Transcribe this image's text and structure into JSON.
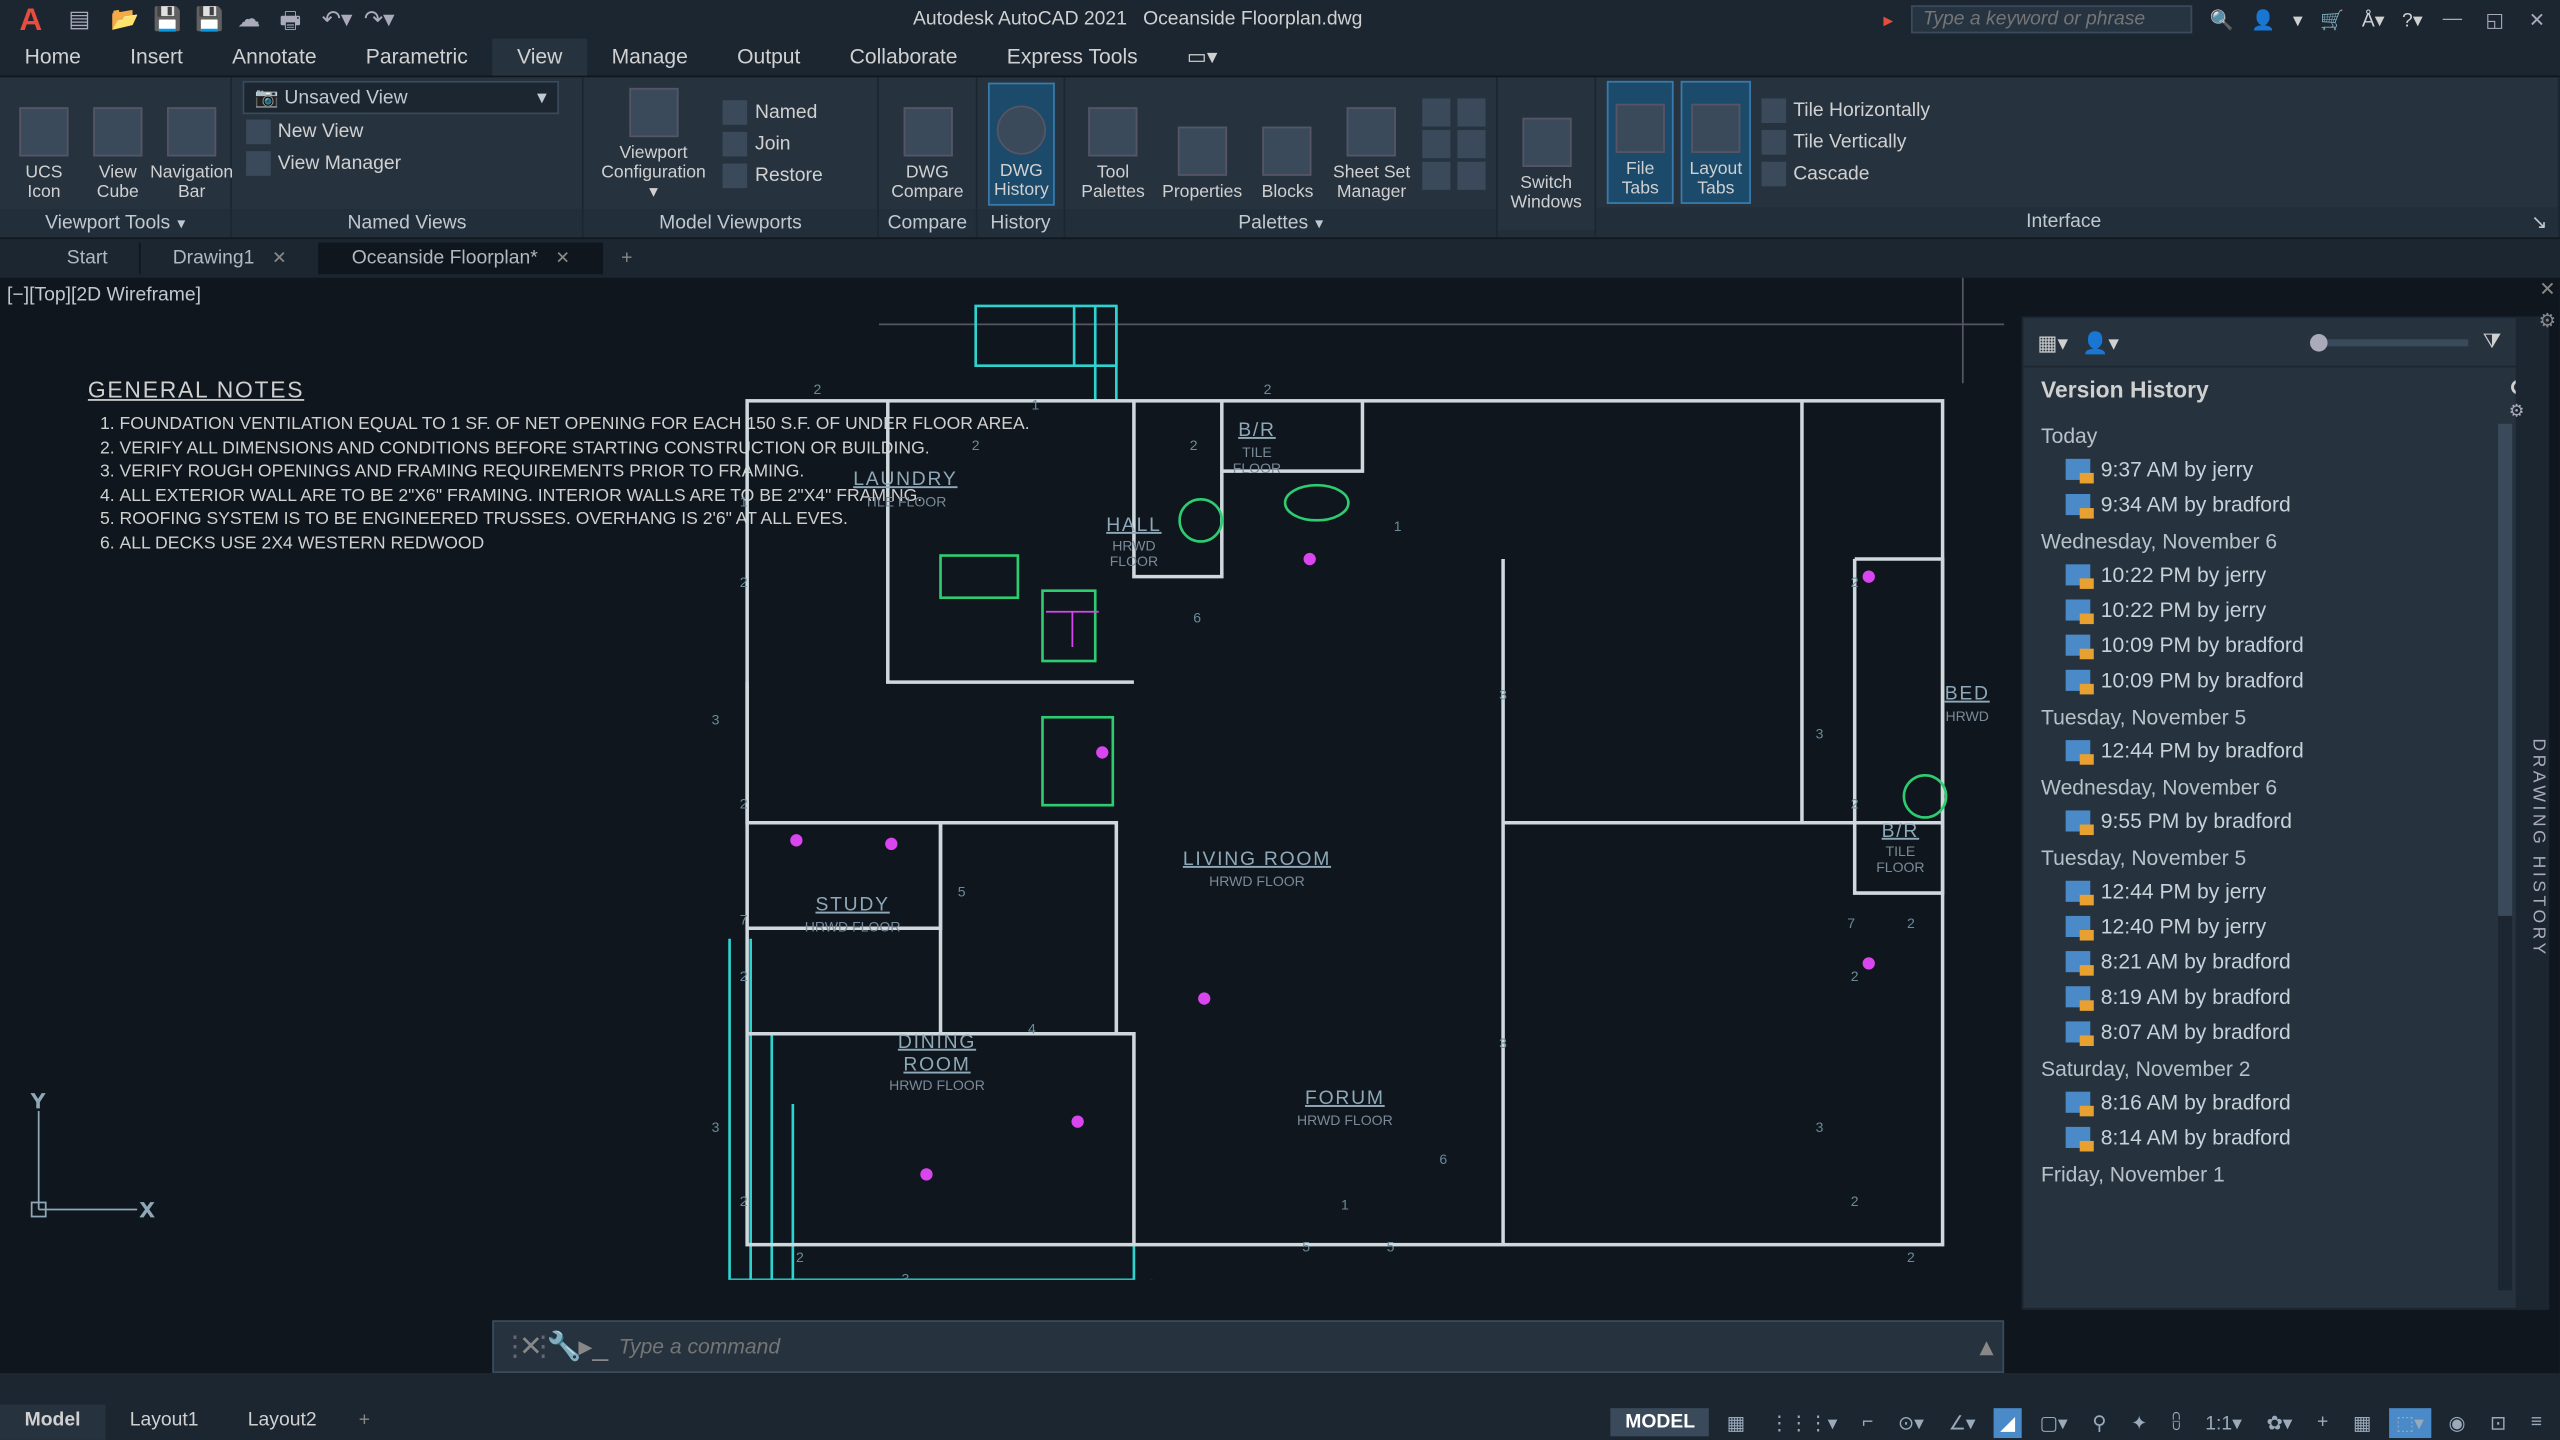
{
  "app": {
    "name": "Autodesk AutoCAD 2021",
    "doc": "Oceanside Floorplan.dwg"
  },
  "search": {
    "placeholder": "Type a keyword or phrase"
  },
  "menu": [
    "Home",
    "Insert",
    "Annotate",
    "Parametric",
    "View",
    "Manage",
    "Output",
    "Collaborate",
    "Express Tools"
  ],
  "menu_active": "View",
  "ribbon": {
    "viewport_tools": {
      "ucs": "UCS\nIcon",
      "cube": "View\nCube",
      "nav": "Navigation\nBar",
      "title": "Viewport Tools"
    },
    "named_views": {
      "combo": "Unsaved View",
      "named": "Named",
      "new": "New View",
      "mgr": "View Manager",
      "title": "Named Views"
    },
    "model_vp": {
      "cfg": "Viewport\nConfiguration",
      "join": "Join",
      "restore": "Restore",
      "title": "Model Viewports"
    },
    "compare": {
      "dwg": "DWG\nCompare",
      "title": "Compare"
    },
    "history": {
      "dwg": "DWG\nHistory",
      "title": "History"
    },
    "palettes": {
      "tool": "Tool\nPalettes",
      "prop": "Properties",
      "blocks": "Blocks",
      "sheet": "Sheet Set\nManager",
      "title": "Palettes"
    },
    "switch": "Switch\nWindows",
    "interface": {
      "file": "File\nTabs",
      "layout": "Layout\nTabs",
      "th": "Tile Horizontally",
      "tv": "Tile Vertically",
      "cas": "Cascade",
      "title": "Interface"
    }
  },
  "doctabs": [
    "Start",
    "Drawing1",
    "Oceanside Floorplan*"
  ],
  "viewlabel": "[−][Top][2D Wireframe]",
  "notes": {
    "title": "GENERAL NOTES",
    "items": [
      "FOUNDATION VENTILATION EQUAL TO 1 SF. OF NET OPENING FOR EACH 150 S.F. OF UNDER FLOOR AREA.",
      "VERIFY ALL DIMENSIONS AND CONDITIONS BEFORE STARTING CONSTRUCTION OR BUILDING.",
      "VERIFY ROUGH OPENINGS AND FRAMING REQUIREMENTS PRIOR TO FRAMING.",
      "ALL EXTERIOR WALL ARE TO BE 2\"X6\" FRAMING. INTERIOR WALLS ARE TO BE 2\"X4\" FRAMING.",
      "ROOFING SYSTEM IS TO BE ENGINEERED TRUSSES. OVERHANG IS 2'6\" AT ALL EVES.",
      "ALL DECKS USE 2X4 WESTERN REDWOOD"
    ]
  },
  "rooms": {
    "laundry": {
      "n": "LAUNDRY",
      "s": "TILE  FLOOR"
    },
    "br": {
      "n": "B/R",
      "s": "TILE\nFLOOR"
    },
    "hall": {
      "n": "HALL",
      "s": "HRWD\nFLOOR"
    },
    "living": {
      "n": "LIVING  ROOM",
      "s": "HRWD  FLOOR"
    },
    "study": {
      "n": "STUDY",
      "s": "HRWD  FLOOR"
    },
    "dining": {
      "n": "DINING\nROOM",
      "s": "HRWD  FLOOR"
    },
    "forum": {
      "n": "FORUM",
      "s": "HRWD  FLOOR"
    },
    "bed": {
      "n": "BED",
      "s": "HRWD"
    },
    "br2": {
      "n": "B/R",
      "s": "TILE\nFLOOR"
    }
  },
  "vh": {
    "title": "Version History",
    "groups": [
      {
        "d": "Today",
        "items": [
          "9:37 AM by jerry",
          "9:34 AM by bradford"
        ]
      },
      {
        "d": "Wednesday, November 6",
        "items": [
          "10:22 PM by jerry",
          "10:22 PM by jerry",
          "10:09 PM by bradford",
          "10:09 PM by bradford"
        ]
      },
      {
        "d": "Tuesday, November 5",
        "items": [
          "12:44 PM by bradford"
        ]
      },
      {
        "d": "Wednesday, November 6",
        "items": [
          "9:55 PM by bradford"
        ]
      },
      {
        "d": "Tuesday, November 5",
        "items": [
          "12:44 PM by jerry",
          "12:40 PM by jerry",
          "8:21 AM by bradford",
          "8:19 AM by bradford",
          "8:07 AM by bradford"
        ]
      },
      {
        "d": "Saturday, November 2",
        "items": [
          "8:16 AM by bradford",
          "8:14 AM by bradford"
        ]
      },
      {
        "d": "Friday, November 1",
        "items": []
      }
    ],
    "side": "DRAWING HISTORY"
  },
  "cmd": {
    "placeholder": "Type a command"
  },
  "layouts": [
    "Model",
    "Layout1",
    "Layout2"
  ],
  "status": {
    "model": "MODEL",
    "scale": "1:1"
  }
}
